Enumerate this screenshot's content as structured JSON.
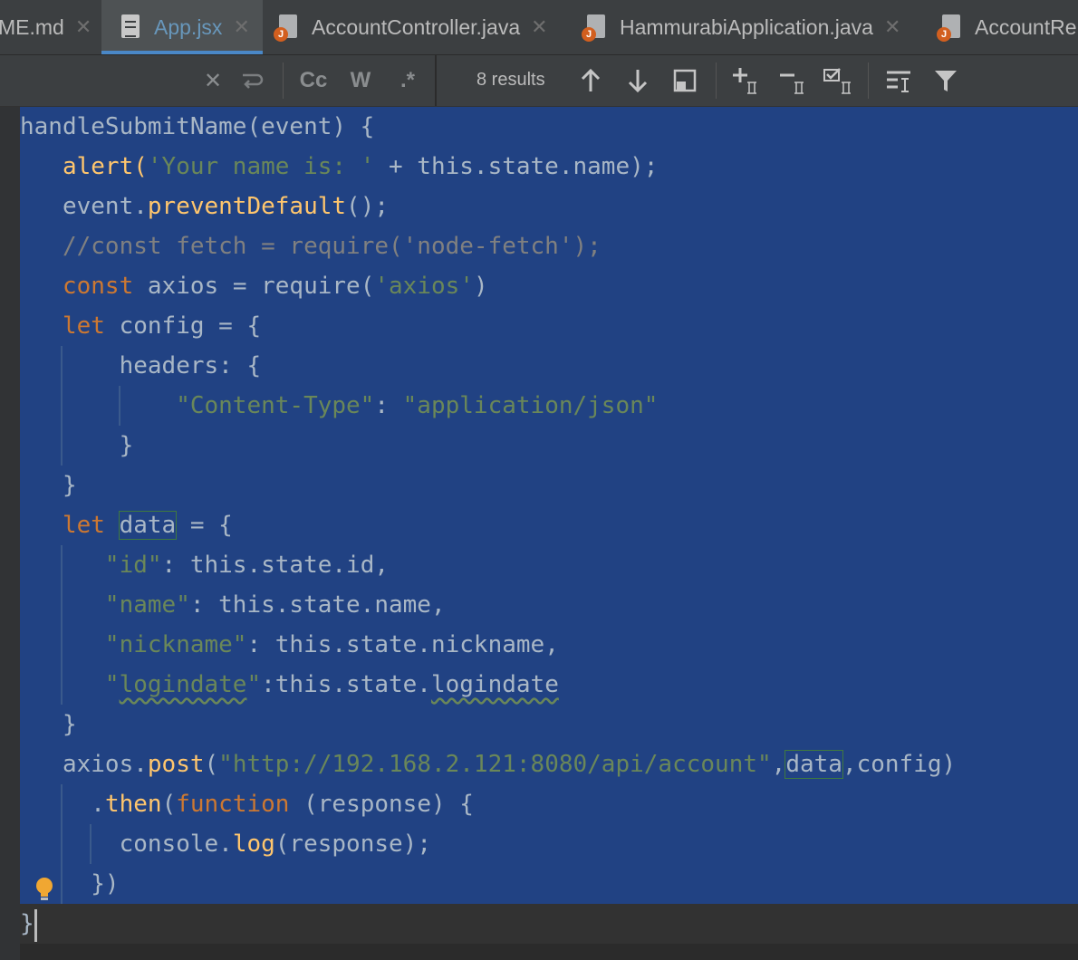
{
  "tabs": [
    {
      "label": "ME.md",
      "active": false
    },
    {
      "label": "App.jsx",
      "active": true
    },
    {
      "label": "AccountController.java",
      "active": false
    },
    {
      "label": "HammurabiApplication.java",
      "active": false
    },
    {
      "label": "AccountRe",
      "active": false
    }
  ],
  "search": {
    "results": "8 results",
    "match_case": "Cc",
    "words": "W",
    "regex": ".*"
  },
  "code": {
    "l1": "handleSubmitName(event) {",
    "l2a": "alert(",
    "l2b": "'Your name is: '",
    "l2c": " + this.state.name);",
    "l3a": "event.",
    "l3b": "preventDefault",
    "l3c": "();",
    "l4": "//const fetch = require('node-fetch');",
    "l5a": "const",
    "l5b": " axios = require(",
    "l5c": "'axios'",
    "l5d": ")",
    "l6a": "let",
    "l6b": " config = {",
    "l7": "headers: {",
    "l8a": "\"Content-Type\"",
    "l8b": ": ",
    "l8c": "\"application/json\"",
    "l9": "}",
    "l10": "}",
    "l11a": "let",
    "l11b": "data",
    "l11c": " = {",
    "l12a": "\"id\"",
    "l12b": ": this.state.id,",
    "l13a": "\"name\"",
    "l13b": ": this.state.name,",
    "l14a": "\"nickname\"",
    "l14b": ": this.state.nickname,",
    "l15a": "\"",
    "l15b": "logindate",
    "l15c": "\"",
    "l15d": ":this.state.",
    "l15e": "logindate",
    "l16": "}",
    "l17a": "axios.",
    "l17b": "post",
    "l17c": "(",
    "l17d": "\"http://192.168.2.121:8080/api/account\"",
    "l17e": ",",
    "l17f": "data",
    "l17g": ",config)",
    "l18a": ".",
    "l18b": "then",
    "l18c": "(",
    "l18d": "function",
    "l18e": " (response) {",
    "l19a": "console.",
    "l19b": "log",
    "l19c": "(response);",
    "l20": "})",
    "l21": "}"
  }
}
